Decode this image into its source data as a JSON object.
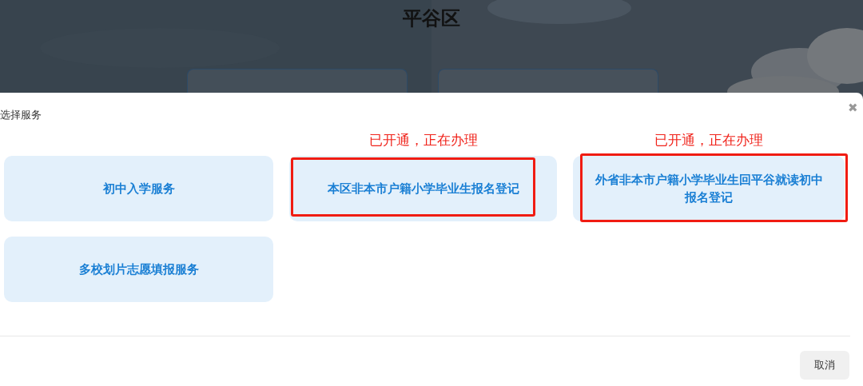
{
  "page": {
    "title": "平谷区",
    "level_cards": [
      {
        "kind": "card"
      },
      {
        "kind": "card"
      }
    ]
  },
  "dialog": {
    "title": "选择服务",
    "close": "✖",
    "services": [
      {
        "label": "初中入学服务"
      },
      {
        "label": "本区非本市户籍小学毕业生报名登记",
        "annotation": "已开通，正在办理"
      },
      {
        "label": "外省非本市户籍小学毕业生回平谷就读初中报名登记",
        "annotation": "已开通，正在办理"
      },
      {
        "label": "多校划片志愿填报服务"
      }
    ],
    "buttons": [
      "取消"
    ]
  }
}
